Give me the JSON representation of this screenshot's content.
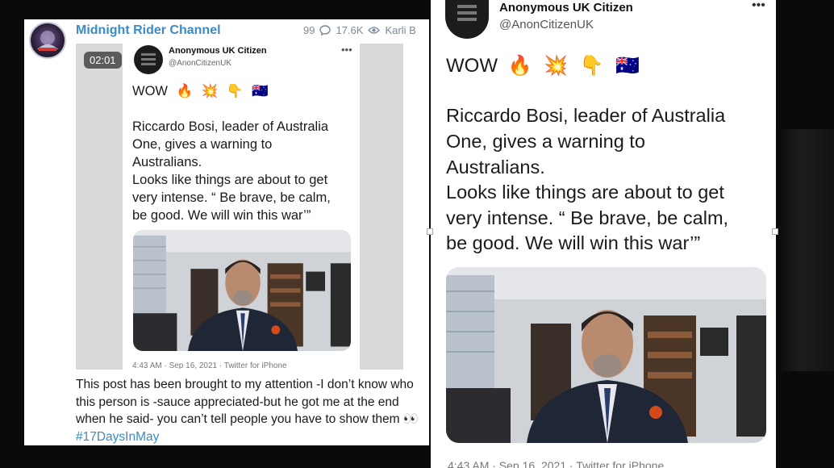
{
  "channel": {
    "name": "Midnight Rider Channel",
    "reply_count": "99",
    "view_count": "17.6K",
    "author": "Karli B"
  },
  "video": {
    "duration": "02:01"
  },
  "tweet": {
    "author_name": "Anonymous UK Citizen",
    "handle": "@AnonCitizenUK",
    "more": "•••",
    "headline": "WOW",
    "emojis": [
      "🔥",
      "💥",
      "👇",
      "🇦🇺"
    ],
    "emoji_names": [
      "fire-icon",
      "collision-icon",
      "pointing-down-icon",
      "australia-flag-icon"
    ],
    "lines": [
      "Riccardo Bosi, leader of Australia",
      "One, gives a warning to",
      "Australians.",
      "Looks like things are about to get",
      "very intense. “ Be brave, be calm,",
      "be good. We will win this war’”"
    ],
    "meta": "4:43 AM · Sep 16, 2021 · Twitter for iPhone"
  },
  "caption": {
    "text": "This post has been brought to my attention -I don’t know who this person is -sauce appreciated-but he got me at the end when he said- you can’t tell people you have to show them ",
    "emoji": "👀",
    "hashtag": "#17DaysInMay"
  },
  "colors": {
    "link": "#3a8bc8",
    "background": "#0a0a0a",
    "panel": "#ffffff"
  }
}
